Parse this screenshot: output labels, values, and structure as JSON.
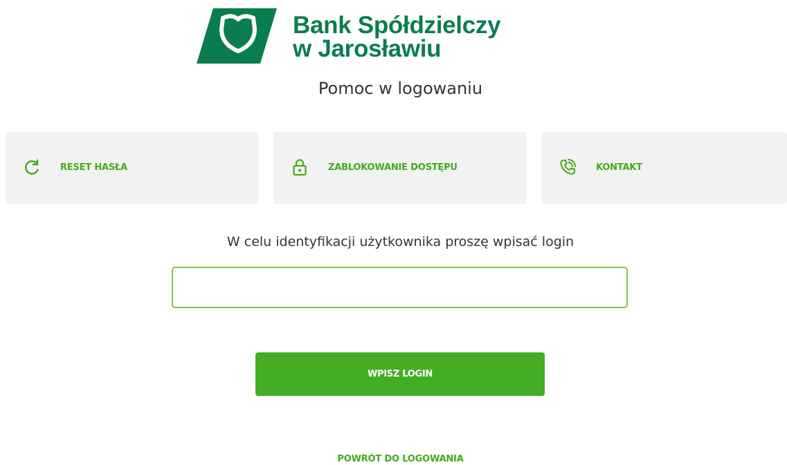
{
  "brand": {
    "logo_line1": "Bank Spółdzielczy",
    "logo_line2": "w Jarosławiu",
    "color": "#0a7d4f",
    "logo_icon": "heart-shield-icon"
  },
  "page_title": "Pomoc w logowaniu",
  "options": [
    {
      "label": "RESET HASŁA",
      "icon": "refresh-icon"
    },
    {
      "label": "ZABLOKOWANIE DOSTĘPU",
      "icon": "padlock-icon"
    },
    {
      "label": "KONTAKT",
      "icon": "phone-ringing-icon"
    }
  ],
  "identification": {
    "prompt": "W celu identyfikacji użytkownika proszę wpisać login",
    "login_value": "",
    "login_placeholder": ""
  },
  "submit_label": "WPISZ LOGIN",
  "back_link": "POWRÓT DO LOGOWANIA",
  "colors": {
    "accent": "#44ad23",
    "input_border": "#7dc453",
    "tile_bg": "#f2f2f2",
    "text": "#333333"
  }
}
